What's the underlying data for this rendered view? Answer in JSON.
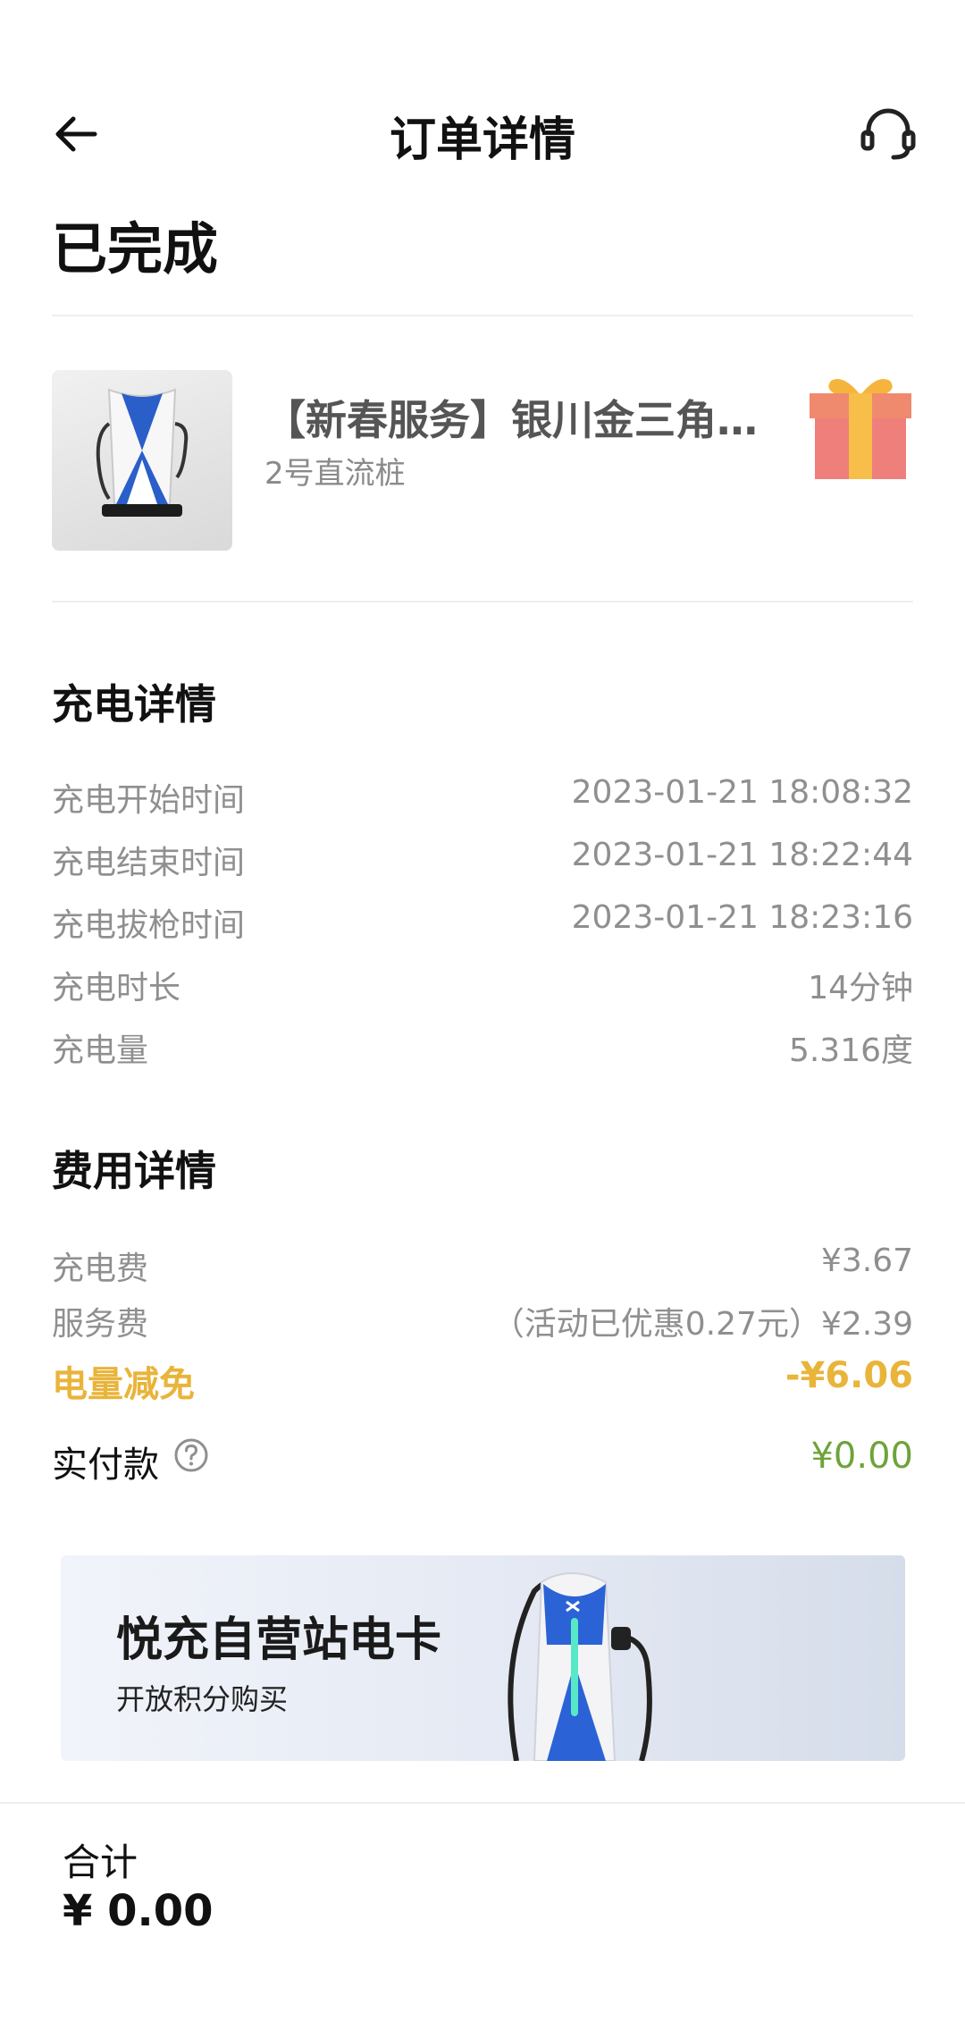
{
  "header": {
    "title": "订单详情",
    "back_icon": "arrow-left-icon",
    "support_icon": "headset-icon"
  },
  "order_status": "已完成",
  "station": {
    "name": "【新春服务】银川金三角…",
    "charger": "2号直流桩",
    "gift_icon": "gift-icon"
  },
  "charging": {
    "title": "充电详情",
    "rows": [
      {
        "label": "充电开始时间",
        "value": "2023-01-21 18:08:32"
      },
      {
        "label": "充电结束时间",
        "value": "2023-01-21 18:22:44"
      },
      {
        "label": "充电拔枪时间",
        "value": "2023-01-21 18:23:16"
      },
      {
        "label": "充电时长",
        "value": "14分钟"
      },
      {
        "label": "充电量",
        "value": "5.316度"
      }
    ]
  },
  "fees": {
    "title": "费用详情",
    "rows": [
      {
        "label": "充电费",
        "value": "¥3.67"
      },
      {
        "label": "服务费",
        "value": "（活动已优惠0.27元）¥2.39"
      },
      {
        "label": "电量减免",
        "value": "-¥6.06"
      }
    ],
    "paid": {
      "label": "实付款",
      "value": "¥0.00",
      "help_icon": "question-circle-icon"
    }
  },
  "banner": {
    "title": "悦充自营站电卡",
    "subtitle": "开放积分购买"
  },
  "footer": {
    "total_label": "合计",
    "total_value": "¥ 0.00"
  },
  "colors": {
    "discount": "#e9b43a",
    "paid": "#6fa33a",
    "muted": "#8f8f8f"
  }
}
